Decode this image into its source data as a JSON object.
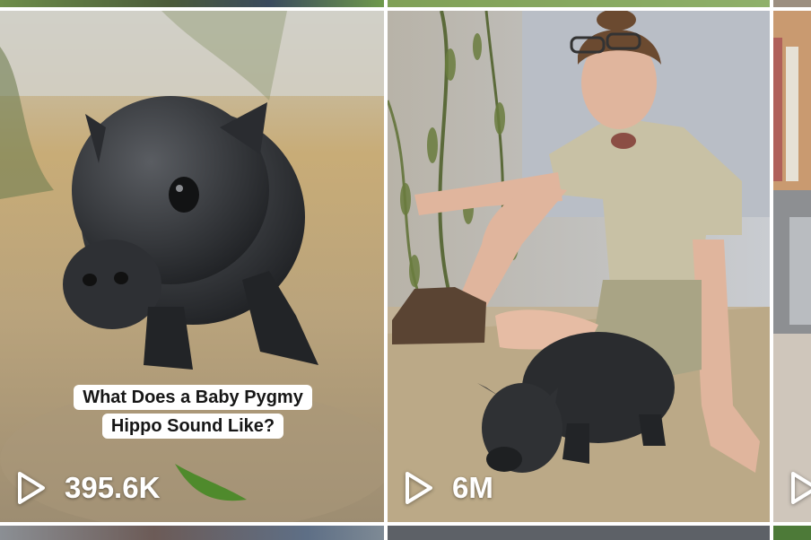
{
  "grid": {
    "videos": [
      {
        "caption_line1": "What Does a Baby Pygmy",
        "caption_line2": "Hippo Sound Like?",
        "views": "395.6K",
        "play_icon": "play-icon"
      },
      {
        "views": "6M",
        "play_icon": "play-icon"
      },
      {
        "play_icon": "play-icon"
      }
    ]
  }
}
